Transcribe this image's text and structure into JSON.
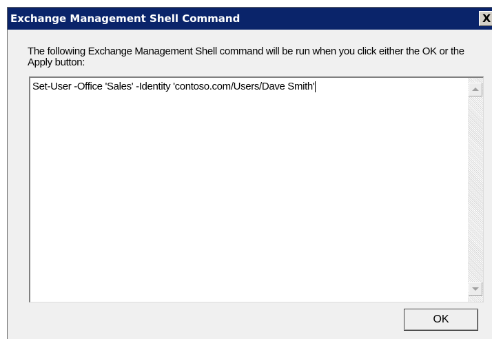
{
  "dialog": {
    "title": "Exchange Management Shell Command",
    "close_label": "X",
    "description": "The following Exchange Management Shell command will be run when you click either the OK or the Apply button:",
    "command": "Set-User -Office 'Sales' -Identity 'contoso.com/Users/Dave Smith'",
    "ok_label": "OK"
  },
  "colors": {
    "titlebar": "#0a246a",
    "dialog_bg": "#f0f0f0"
  },
  "icons": {
    "close": "close-icon",
    "scroll_up": "scroll-up-arrow-icon",
    "scroll_down": "scroll-down-arrow-icon"
  }
}
